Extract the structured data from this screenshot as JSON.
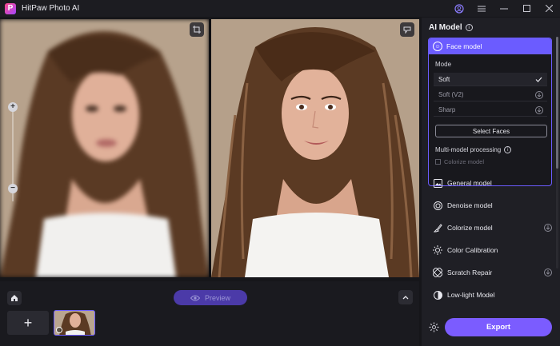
{
  "app": {
    "title": "HitPaw Photo AI"
  },
  "titlebar": {
    "icons": [
      "account-icon",
      "menu-icon",
      "minimize-icon",
      "maximize-icon",
      "close-icon"
    ]
  },
  "preview": {
    "preview_label": "Preview"
  },
  "panel": {
    "title": "AI Model",
    "face_model": {
      "label": "Face model",
      "mode_label": "Mode",
      "modes": [
        {
          "label": "Soft",
          "state": "selected"
        },
        {
          "label": "Soft (V2)",
          "state": "download"
        },
        {
          "label": "Sharp",
          "state": "download"
        }
      ],
      "select_faces_label": "Select Faces",
      "multi_label": "Multi-model processing",
      "colorize_label": "Colorize model"
    },
    "models": [
      {
        "label": "General model",
        "icon": "image-icon",
        "download": false
      },
      {
        "label": "Denoise model",
        "icon": "denoise-icon",
        "download": false
      },
      {
        "label": "Colorize model",
        "icon": "brush-icon",
        "download": true
      },
      {
        "label": "Color Calibration",
        "icon": "sun-icon",
        "download": false
      },
      {
        "label": "Scratch Repair",
        "icon": "bandage-icon",
        "download": true
      },
      {
        "label": "Low-light Model",
        "icon": "contrast-icon",
        "download": false
      }
    ],
    "export_label": "Export"
  },
  "colors": {
    "accent": "#6b5cff",
    "export": "#7b5cff",
    "panel_bg": "#1f1f25"
  }
}
